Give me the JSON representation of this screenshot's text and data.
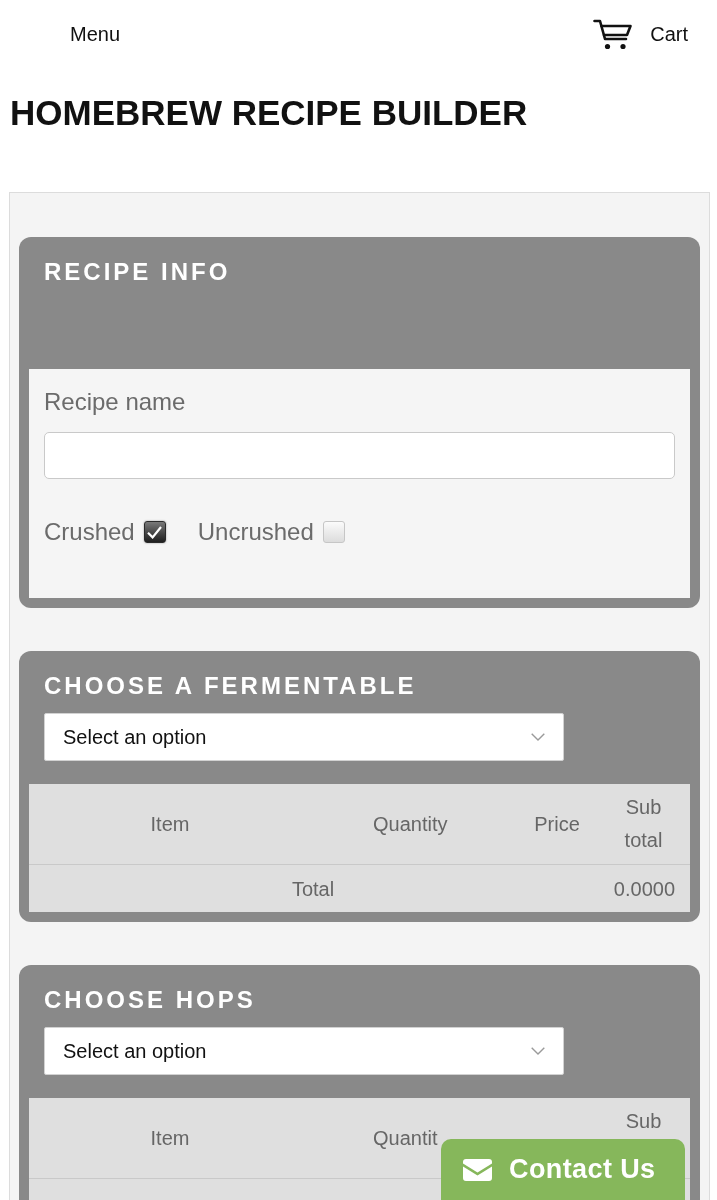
{
  "header": {
    "menu_label": "Menu",
    "cart_label": "Cart"
  },
  "title": "HOMEBREW RECIPE BUILDER",
  "sections": [
    {
      "kind": "info",
      "heading": "RECIPE INFO",
      "field": {
        "label": "Recipe name"
      },
      "options": [
        {
          "label": "Crushed",
          "checked": true
        },
        {
          "label": "Uncrushed",
          "checked": false
        }
      ]
    },
    {
      "kind": "picker",
      "heading": "CHOOSE A FERMENTABLE",
      "select": {
        "value": "Select an option"
      },
      "table": {
        "columns": [
          {
            "kind": "item",
            "label": "Item"
          },
          {
            "kind": "quantity",
            "label": "Quantity"
          },
          {
            "kind": "price",
            "label": "Price"
          },
          {
            "kind": "subtotal",
            "label": "Sub total"
          }
        ],
        "total": {
          "label": "Total",
          "value": "0.0000"
        }
      }
    },
    {
      "kind": "picker",
      "heading": "CHOOSE HOPS",
      "select": {
        "value": "Select an option"
      },
      "table": {
        "columns": [
          {
            "kind": "item",
            "label": "Item"
          },
          {
            "kind": "quantity",
            "label": "Quantit"
          },
          {
            "kind": "subtotal",
            "label": "Sub"
          }
        ]
      }
    }
  ],
  "contact_button": {
    "label": "Contact Us"
  }
}
